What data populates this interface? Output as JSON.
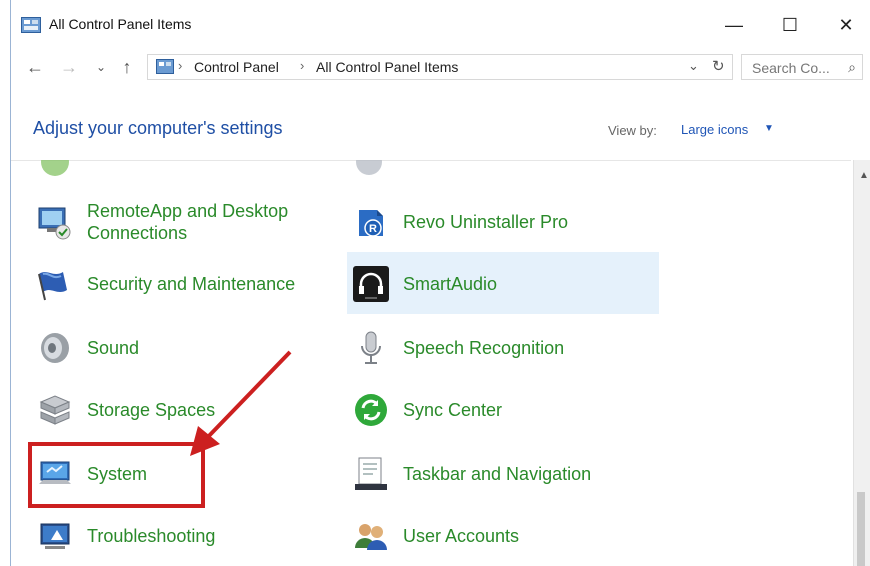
{
  "window": {
    "title": "All Control Panel Items",
    "minimize": "—",
    "maximize": "☐",
    "close": "✕"
  },
  "nav": {
    "back": "←",
    "forward": "→",
    "recent": "⌄",
    "up": "↑",
    "breadcrumb": [
      "Control Panel",
      "All Control Panel Items"
    ],
    "separator": "›",
    "dropdown": "⌄",
    "refresh": "↻",
    "search_placeholder": "Search Co...",
    "search_icon": "⌕"
  },
  "header": {
    "title": "Adjust your computer's settings",
    "view_by_label": "View by:",
    "view_by_value": "Large icons",
    "caret": "▼"
  },
  "items_left": [
    {
      "label": "RemoteApp and Desktop Connections",
      "icon": "remoteapp-icon"
    },
    {
      "label": "Security and Maintenance",
      "icon": "flag-icon"
    },
    {
      "label": "Sound",
      "icon": "speaker-icon"
    },
    {
      "label": "Storage Spaces",
      "icon": "storage-icon"
    },
    {
      "label": "System",
      "icon": "system-icon"
    },
    {
      "label": "Troubleshooting",
      "icon": "troubleshooting-icon"
    }
  ],
  "items_right": [
    {
      "label": "Revo Uninstaller Pro",
      "icon": "revo-icon"
    },
    {
      "label": "SmartAudio",
      "icon": "headphones-icon"
    },
    {
      "label": "Speech Recognition",
      "icon": "microphone-icon"
    },
    {
      "label": "Sync Center",
      "icon": "sync-icon"
    },
    {
      "label": "Taskbar and Navigation",
      "icon": "taskbar-icon"
    },
    {
      "label": "User Accounts",
      "icon": "users-icon"
    }
  ],
  "colors": {
    "link_green": "#2a8a2a",
    "heading_blue": "#1f4fa5",
    "annotation_red": "#cc2020",
    "hover_blue": "#e5f1fb"
  }
}
